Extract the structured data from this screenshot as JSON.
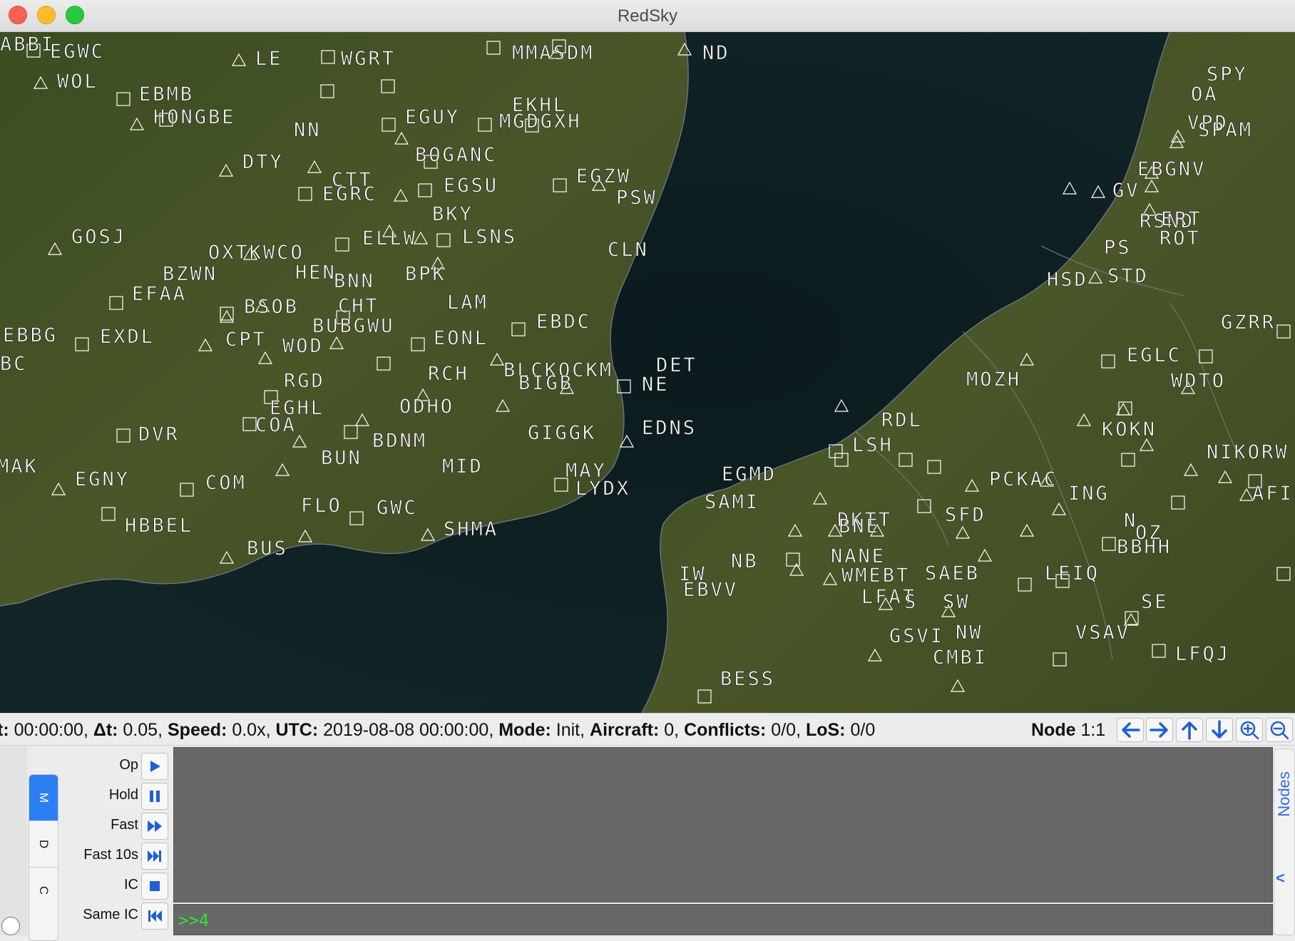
{
  "window": {
    "title": "RedSky"
  },
  "status": {
    "sim_time_label": "t:",
    "sim_time": "00:00:00",
    "dt_label": "Δt:",
    "dt": "0.05",
    "speed_label": "Speed:",
    "speed": "0.0x",
    "utc_label": "UTC:",
    "utc": "2019-08-08 00:00:00",
    "mode_label": "Mode:",
    "mode": "Init",
    "aircraft_label": "Aircraft:",
    "aircraft": "0",
    "conflicts_label": "Conflicts:",
    "conflicts": "0/0",
    "los_label": "LoS:",
    "los": "0/0",
    "node_label": "Node",
    "node": "1:1"
  },
  "nav_icons": [
    "arrow-left-icon",
    "arrow-right-icon",
    "arrow-up-icon",
    "arrow-down-icon",
    "zoom-in-icon",
    "zoom-out-icon"
  ],
  "side_tabs": [
    {
      "label": "M",
      "active": true
    },
    {
      "label": "D",
      "active": false
    },
    {
      "label": "C",
      "active": false
    }
  ],
  "controls": [
    {
      "label": "Op",
      "icon": "play-icon"
    },
    {
      "label": "Hold",
      "icon": "pause-icon"
    },
    {
      "label": "Fast",
      "icon": "fast-forward-icon"
    },
    {
      "label": "Fast 10s",
      "icon": "skip-forward-icon"
    },
    {
      "label": "IC",
      "icon": "stop-icon"
    },
    {
      "label": "Same IC",
      "icon": "skip-back-icon"
    }
  ],
  "console": {
    "input": ">>4"
  },
  "right_panel": {
    "label": "Nodes",
    "collapse": "<"
  },
  "colors": {
    "accent": "#2c7ef3",
    "console_bg": "#676767",
    "prompt": "#2ee82e",
    "waypoint": "#ffffff"
  },
  "map": {
    "labels": [
      "EGWC",
      "WOL",
      "LE",
      "WGRT",
      "MMASDM",
      "ND",
      "SPY",
      "OA",
      "EBMB",
      "HONGBE",
      "NN",
      "EGUY",
      "EKHL",
      "MGDGXH",
      "DTY",
      "CTT",
      "EGRC",
      "BOGANC",
      "EGSU",
      "EGZW",
      "PSW",
      "GV",
      "EBGNV",
      "VPD",
      "SPAM",
      "BKY",
      "GOSJ",
      "OXTKWCO",
      "ELLW",
      "LSNS",
      "CLN",
      "PS",
      "RSND",
      "ERT",
      "ROT",
      "BZWN",
      "HEN",
      "BNN",
      "BPK",
      "HSD",
      "STD",
      "EFAA",
      "BSOB",
      "CHT",
      "LAM",
      "EBDC",
      "GZRR",
      "EBBG",
      "EXDL",
      "CPT",
      "WOD",
      "BUBGWU",
      "EONL",
      "EGLC",
      "WDTO",
      "BC",
      "RGD",
      "BLCKOCKM",
      "RCH",
      "BIGB",
      "DET",
      "NE",
      "MOZH",
      "COA",
      "EGHL",
      "ODHO",
      "RDL",
      "EDNS",
      "DVR",
      "BDNM",
      "GIGGK",
      "LSH",
      "KOKN",
      "NIKORW",
      "BUN",
      "MID",
      "MAY",
      "LYDX",
      "EGMD",
      "PCKAC",
      "MAK",
      "EGNY",
      "COM",
      "SAMI",
      "ING",
      "AFIBBR",
      "FLO",
      "GWC",
      "SHMA",
      "SFD",
      "DKTT",
      "N",
      "OZ",
      "HBBEL",
      "BBHH",
      "BUS",
      "IW",
      "NB",
      "BNE",
      "NANE",
      "WMEBT",
      "SAEB",
      "LEIQ",
      "EBVV",
      "LFAT",
      "S",
      "SW",
      "SE",
      "GSVI",
      "NW",
      "VSAV",
      "LFQJ",
      "CMBI",
      "BESS",
      "ABBI"
    ]
  }
}
